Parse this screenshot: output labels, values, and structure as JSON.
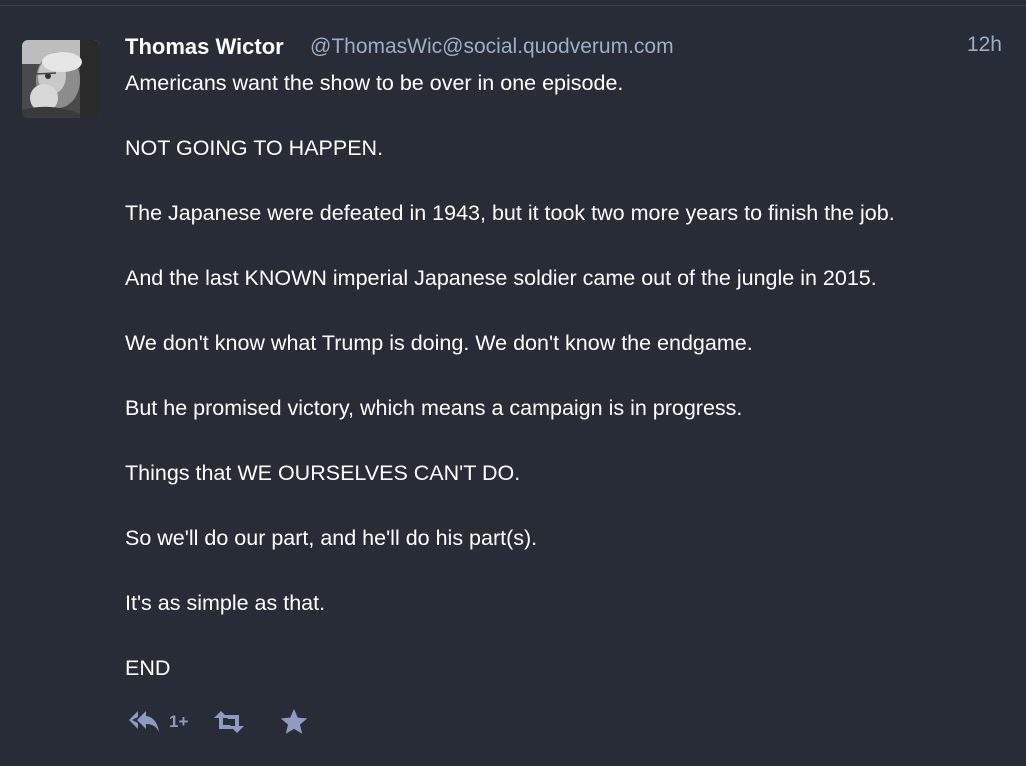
{
  "status": {
    "author": {
      "display_name": "Thomas Wictor",
      "acct": "@ThomasWic@social.quodverum.com",
      "avatar_icon": "avatar-photo-icon"
    },
    "timestamp": "12h",
    "paragraphs": [
      "Americans want the show to be over in one episode.",
      "NOT GOING TO HAPPEN.",
      "The Japanese were defeated in 1943, but it took two more years to finish the job.",
      "And the last KNOWN imperial Japanese soldier came out of the jungle in 2015.",
      "We don't know what Trump is doing. We don't know the endgame.",
      "But he promised victory, which means a campaign is in progress.",
      "Things that WE OURSELVES CAN'T DO.",
      "So we'll do our part, and he'll do his part(s).",
      "It's as simple as that.",
      "END"
    ],
    "actions": {
      "reply_icon": "reply-all-icon",
      "reply_count": "1+",
      "boost_icon": "retweet-icon",
      "favourite_icon": "star-icon"
    }
  },
  "colors": {
    "background": "#282c37",
    "text": "#ffffff",
    "muted": "#9baec8",
    "action_icon": "#8d9ac2"
  }
}
